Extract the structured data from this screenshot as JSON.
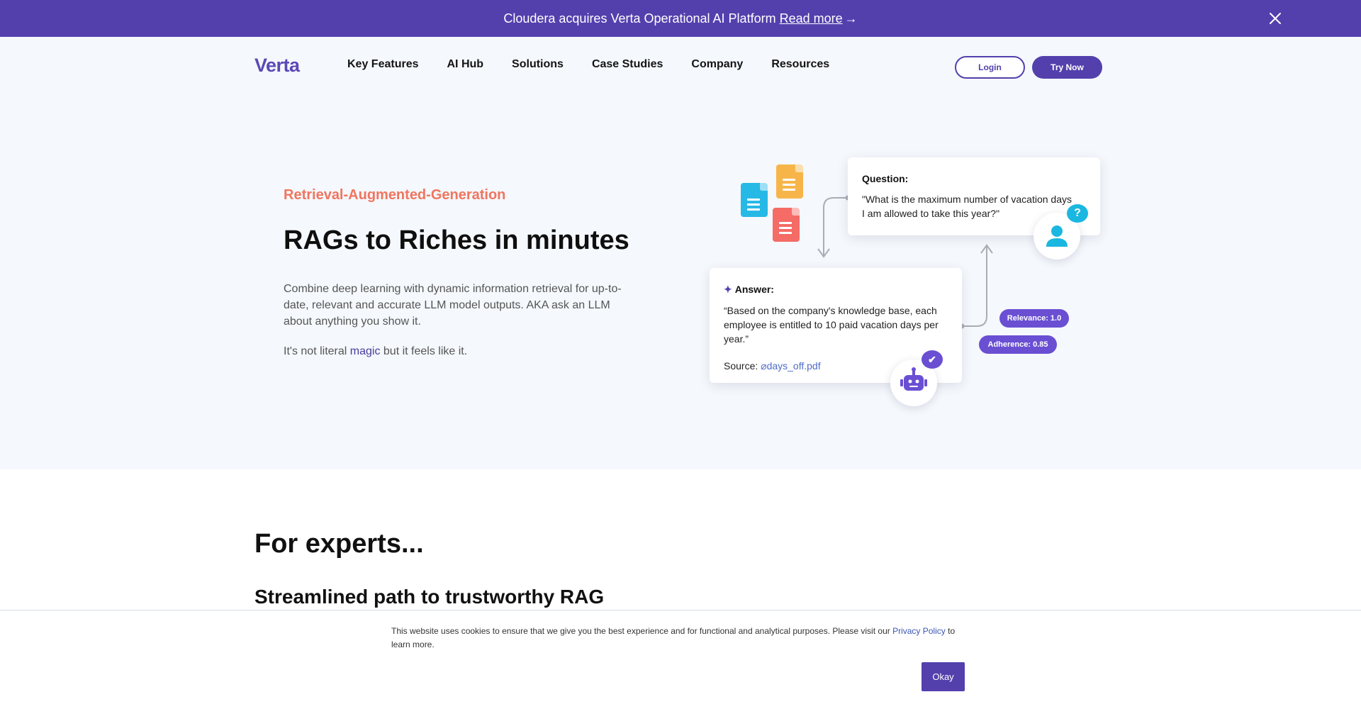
{
  "announcement": {
    "text": "Cloudera acquires Verta Operational AI Platform",
    "link": "Read more",
    "arrow": "→"
  },
  "nav": {
    "logo": "Verta",
    "items": [
      "Key Features",
      "AI Hub",
      "Solutions",
      "Case Studies",
      "Company",
      "Resources"
    ],
    "login": "Login",
    "try_now": "Try Now"
  },
  "hero": {
    "eyebrow": "Retrieval-Augmented-Generation",
    "title": "RAGs to Riches in minutes",
    "description": "Combine deep learning with dynamic information retrieval for up-to-date, relevant and accurate LLM model outputs. AKA ask an LLM about anything you show it.",
    "tagline_before": "It's not literal ",
    "tagline_link": "magic",
    "tagline_after": " but it feels like it."
  },
  "illustration": {
    "question_label": "Question:",
    "question_text": "\"What is the maximum number of vacation days I am allowed to take this year?\"",
    "answer_label": "Answer:",
    "answer_text": "“Based on the company's knowledge base, each employee is entitled to 10 paid vacation days per year.”",
    "source_label": "Source:",
    "source_file": "days_off.pdf",
    "relevance": "Relevance: 1.0",
    "adherence": "Adherence: 0.85",
    "icons": [
      "document-icon",
      "question-bubble-icon",
      "user-icon",
      "robot-icon",
      "checkmark-icon",
      "sparkle-icon",
      "paperclip-icon"
    ]
  },
  "section": {
    "heading": "For experts...",
    "subheading": "Streamlined path to trustworthy RAG"
  },
  "cookie": {
    "text": "This website uses cookies to ensure that we give you the best experience and for functional and analytical purposes. Please visit our",
    "link": "Privacy Policy",
    "text_after": "to learn more.",
    "button": "Okay"
  },
  "colors": {
    "brand": "#5340ad",
    "eyebrow": "#f0755f",
    "hero_bg": "#f5f8fc"
  }
}
